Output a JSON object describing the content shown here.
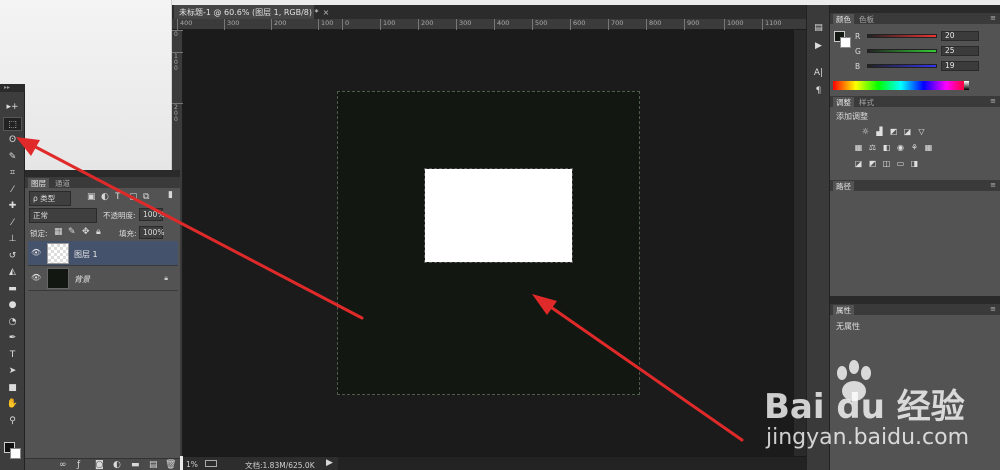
{
  "document": {
    "tab_title": "未标题-1 @ 60.6% (图层 1, RGB/8) *",
    "close_glyph": "×"
  },
  "rulers": {
    "horizontal": [
      "400",
      "300",
      "200",
      "100",
      "0",
      "100",
      "200",
      "300",
      "400",
      "500",
      "600",
      "700",
      "800",
      "900",
      "1000",
      "1100"
    ],
    "vertical": [
      "0",
      "100",
      "200"
    ]
  },
  "status_bar": {
    "zoom": "1%",
    "doc_info": "文档:1.83M/625.0K",
    "arrow_glyph": "▶"
  },
  "tools": [
    "move-icon",
    "marquee-icon",
    "lasso-icon",
    "quick-select-icon",
    "crop-icon",
    "eyedropper-icon",
    "healing-icon",
    "brush-icon",
    "stamp-icon",
    "history-brush-icon",
    "eraser-icon",
    "gradient-icon",
    "blur-icon",
    "dodge-icon",
    "pen-icon",
    "type-icon",
    "path-select-icon",
    "shape-icon",
    "hand-icon",
    "zoom-icon"
  ],
  "layers_panel": {
    "tab_layers": "图层",
    "tab_channels": "通道",
    "filter_kind": "ρ 类型",
    "blend_mode": "正常",
    "opacity_label": "不透明度:",
    "opacity_value": "100%",
    "lock_label": "锁定:",
    "fill_label": "填充:",
    "fill_value": "100%",
    "layers": [
      {
        "name": "图层 1",
        "selected": true,
        "thumb": "transparent"
      },
      {
        "name": "背景",
        "selected": false,
        "thumb": "dark",
        "locked": true
      }
    ]
  },
  "color_panel": {
    "tab_color": "颜色",
    "tab_swatches": "色板",
    "r_label": "R",
    "g_label": "G",
    "b_label": "B",
    "r_value": "20",
    "g_value": "25",
    "b_value": "19"
  },
  "adjustments_panel": {
    "tab_adjust": "调整",
    "tab_styles": "样式",
    "title": "添加调整"
  },
  "paths_panel": {
    "tab_paths": "路径"
  },
  "properties_panel": {
    "tab_properties": "属性",
    "text": "无属性"
  },
  "watermark": {
    "logo": "Bai du 经验",
    "url": "jingyan.baidu.com"
  },
  "colors": {
    "canvas_bg": "#1b1b1b",
    "document_fill": "#131712",
    "selection_fill": "#ffffff",
    "panel_bg": "#535353",
    "arrow": "#e02a2a"
  }
}
